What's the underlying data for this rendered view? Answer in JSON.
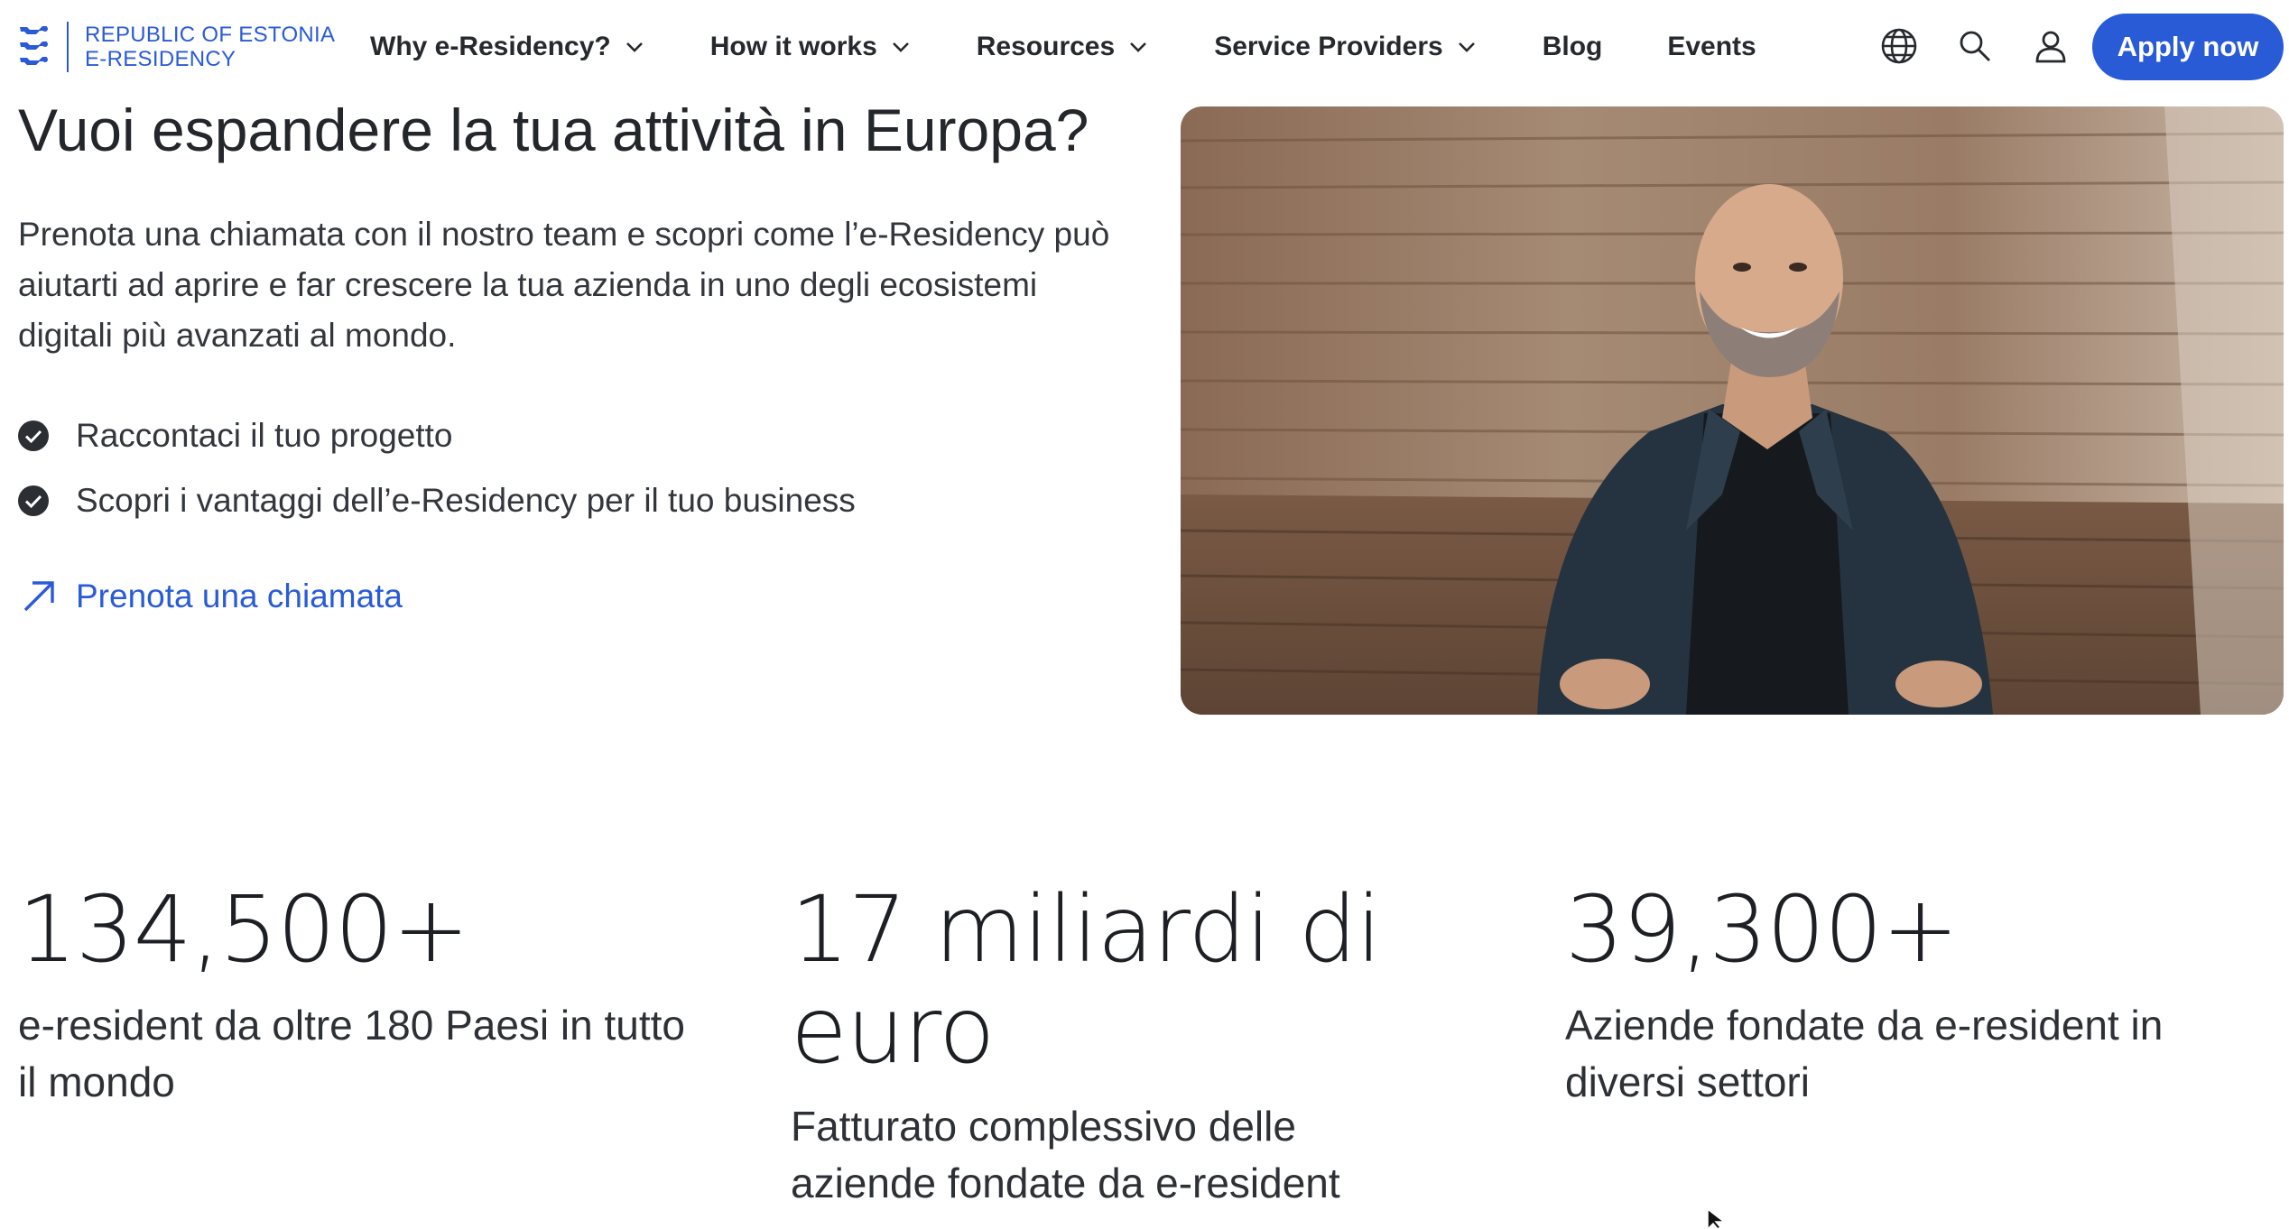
{
  "header": {
    "logo": {
      "line1": "REPUBLIC OF ESTONIA",
      "line2": "E-RESIDENCY",
      "icon": "three-lions-crest-icon"
    },
    "nav": [
      {
        "label": "Why e-Residency?",
        "has_dropdown": true
      },
      {
        "label": "How it works",
        "has_dropdown": true
      },
      {
        "label": "Resources",
        "has_dropdown": true
      },
      {
        "label": "Service Providers",
        "has_dropdown": true
      },
      {
        "label": "Blog",
        "has_dropdown": false
      },
      {
        "label": "Events",
        "has_dropdown": false
      }
    ],
    "icons": [
      "globe-icon",
      "search-icon",
      "user-icon"
    ],
    "apply_label": "Apply now"
  },
  "hero": {
    "title": "Vuoi espandere la tua attività in Europa?",
    "description": "Prenota una chiamata con il nostro team e scopri come l’e-Residency può aiutarti ad aprire e far crescere la tua azienda in uno degli ecosistemi digitali più avanzati al mondo.",
    "checklist": [
      "Raccontaci il tuo progetto",
      "Scopri i vantaggi dell’e-Residency per il tuo business"
    ],
    "cta_label": "Prenota una chiamata"
  },
  "stats": [
    {
      "value": "134,500+",
      "label": "e-resident da oltre 180 Paesi in tutto il mondo"
    },
    {
      "value": "17 miliardi di euro",
      "label": "Fatturato complessivo delle aziende fondate da e-resident"
    },
    {
      "value": "39,300+",
      "label": "Aziende fondate da e-resident in diversi settori"
    }
  ],
  "colors": {
    "accent": "#2a5bd7",
    "text": "#23262b",
    "check": "#2b2e33"
  }
}
